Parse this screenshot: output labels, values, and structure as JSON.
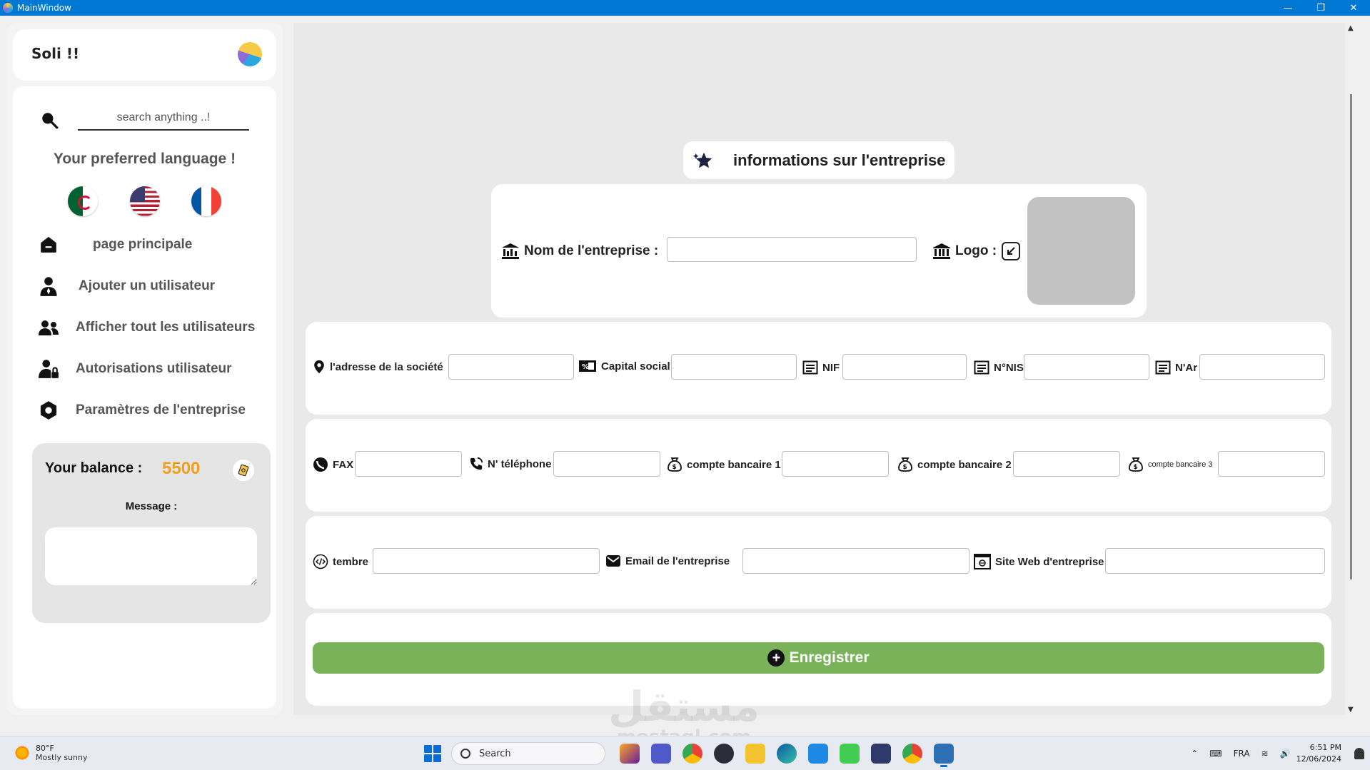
{
  "window": {
    "title": "MainWindow",
    "minimize": "—",
    "restore": "❐",
    "close": "✕"
  },
  "sidebar": {
    "brand": "Soli !!",
    "search_placeholder": "search anything ..!",
    "language_title": "Your preferred language !",
    "languages": [
      "Arabic (Algeria)",
      "English (US)",
      "French"
    ],
    "nav": [
      {
        "label": "page principale",
        "icon": "home-icon"
      },
      {
        "label": "Ajouter un utilisateur",
        "icon": "add-user-icon"
      },
      {
        "label": "Afficher tout les utilisateurs",
        "icon": "users-icon"
      },
      {
        "label": "Autorisations utilisateur",
        "icon": "user-lock-icon"
      },
      {
        "label": "Paramètres de l'entreprise",
        "icon": "settings-hexagon-icon"
      }
    ],
    "balance_label": "Your balance :",
    "balance_value": "5500",
    "message_label": "Message :"
  },
  "form": {
    "section_title": "informations sur l'entreprise",
    "company_name_label": "Nom de l'entreprise :",
    "logo_label": "Logo :",
    "fields_row1": [
      {
        "label": "l'adresse de la société",
        "icon": "location-pin-icon"
      },
      {
        "label": "Capital social",
        "icon": "money-percent-icon"
      },
      {
        "label": "NIF",
        "icon": "document-icon"
      },
      {
        "label": "N°NIS",
        "icon": "document-icon"
      },
      {
        "label": "N'Ar",
        "icon": "document-icon"
      }
    ],
    "fields_row2": [
      {
        "label": "FAX",
        "icon": "fax-icon"
      },
      {
        "label": "N' téléphone",
        "icon": "phone-icon"
      },
      {
        "label": "compte bancaire 1",
        "icon": "money-bag-icon"
      },
      {
        "label": "compte bancaire 2",
        "icon": "money-bag-icon"
      },
      {
        "label": "compte bancaire 3",
        "icon": "money-bag-icon"
      }
    ],
    "fields_row3": [
      {
        "label": "tembre",
        "icon": "stamp-icon"
      },
      {
        "label": "Email de l'entreprise",
        "icon": "envelope-icon"
      },
      {
        "label": "Site Web d'entreprise",
        "icon": "web-page-icon"
      }
    ],
    "save_label": "Enregistrer"
  },
  "watermark": {
    "arabic": "مستقل",
    "latin": "mostaql.com"
  },
  "taskbar": {
    "weather_temp": "80°F",
    "weather_desc": "Mostly sunny",
    "search_label": "Search",
    "language": "FRA",
    "time": "6:51 PM",
    "date": "12/06/2024"
  }
}
